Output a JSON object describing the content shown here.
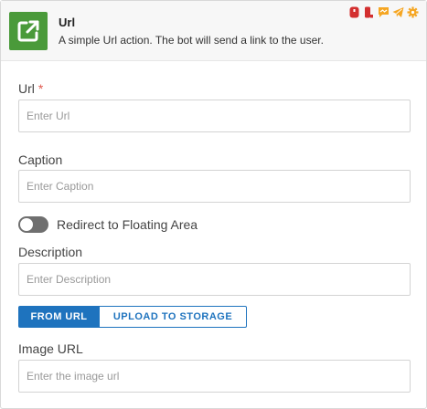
{
  "header": {
    "title": "Url",
    "description": "A simple Url action. The bot will send a link to the user.",
    "icon": "external-link-icon",
    "accent": "#4a9a3a",
    "channels": [
      {
        "name": "web-channel-icon",
        "color": "#d32f2f"
      },
      {
        "name": "mobile-channel-icon",
        "color": "#d32f2f"
      },
      {
        "name": "chat-channel-icon",
        "color": "#f5a623"
      },
      {
        "name": "telegram-icon",
        "color": "#f5a623"
      },
      {
        "name": "settings-channel-icon",
        "color": "#f5a623"
      }
    ]
  },
  "url_field": {
    "label": "Url",
    "required_mark": "*",
    "placeholder": "Enter Url"
  },
  "caption_field": {
    "label": "Caption",
    "placeholder": "Enter Caption"
  },
  "redirect_toggle": {
    "label": "Redirect to Floating Area",
    "on": false
  },
  "description_field": {
    "label": "Description",
    "placeholder": "Enter Description"
  },
  "source_tabs": {
    "from_url": "FROM URL",
    "upload": "UPLOAD TO STORAGE",
    "selected": "FROM URL"
  },
  "image_url_field": {
    "label": "Image URL",
    "placeholder": "Enter the image url"
  },
  "colors": {
    "primary": "#1e73be",
    "required": "#e05a4f",
    "toggle_off": "#6f6f6f"
  }
}
